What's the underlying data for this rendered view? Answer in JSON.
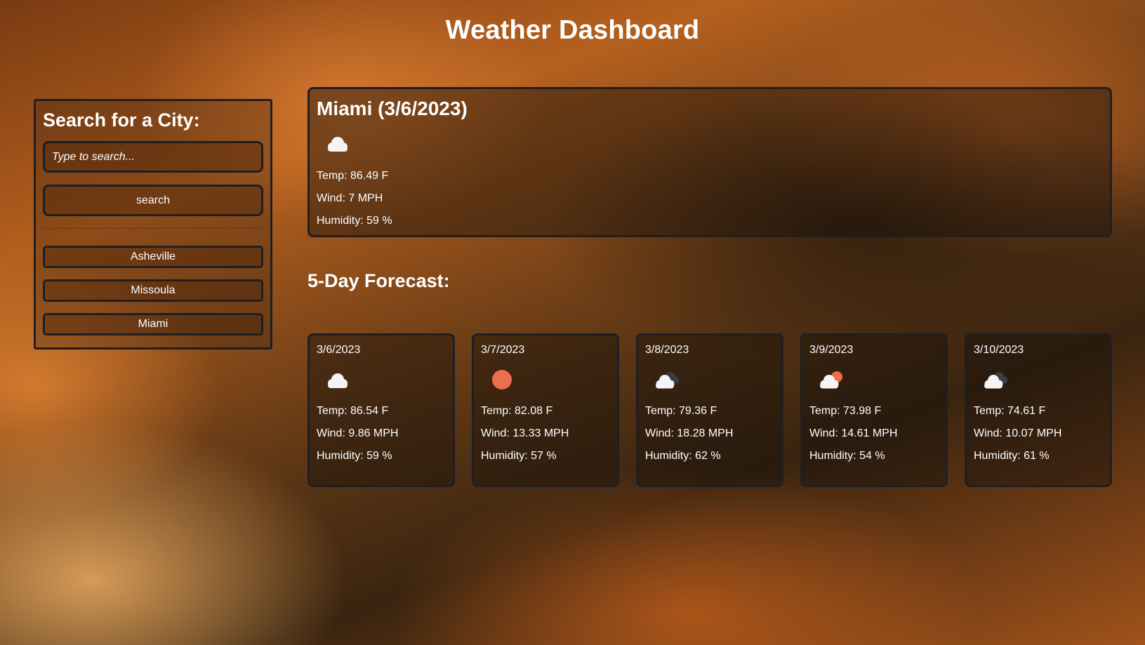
{
  "header": {
    "title": "Weather Dashboard"
  },
  "search": {
    "heading": "Search for a City:",
    "placeholder": "Type to search...",
    "button_label": "search",
    "history": [
      "Asheville",
      "Missoula",
      "Miami"
    ]
  },
  "current": {
    "title": "Miami (3/6/2023)",
    "icon": "cloud-icon",
    "temp": "Temp: 86.49 F",
    "wind": "Wind: 7 MPH",
    "humidity": "Humidity: 59 %"
  },
  "forecast": {
    "heading": "5-Day Forecast:",
    "days": [
      {
        "date": "3/6/2023",
        "icon": "cloud-icon",
        "temp": "Temp: 86.54 F",
        "wind": "Wind: 9.86 MPH",
        "humidity": "Humidity: 59 %"
      },
      {
        "date": "3/7/2023",
        "icon": "sun-icon",
        "temp": "Temp: 82.08 F",
        "wind": "Wind: 13.33 MPH",
        "humidity": "Humidity: 57 %"
      },
      {
        "date": "3/8/2023",
        "icon": "broken-clouds-icon",
        "temp": "Temp: 79.36 F",
        "wind": "Wind: 18.28 MPH",
        "humidity": "Humidity: 62 %"
      },
      {
        "date": "3/9/2023",
        "icon": "partly-cloudy-icon",
        "temp": "Temp: 73.98 F",
        "wind": "Wind: 14.61 MPH",
        "humidity": "Humidity: 54 %"
      },
      {
        "date": "3/10/2023",
        "icon": "broken-clouds-icon",
        "temp": "Temp: 74.61 F",
        "wind": "Wind: 10.07 MPH",
        "humidity": "Humidity: 61 %"
      }
    ]
  },
  "colors": {
    "text": "#ffffff",
    "border": "#1f1f22",
    "sun": "#ec6e4c",
    "cloud_white": "#f4f4f4",
    "cloud_dark": "#3c3c46"
  }
}
